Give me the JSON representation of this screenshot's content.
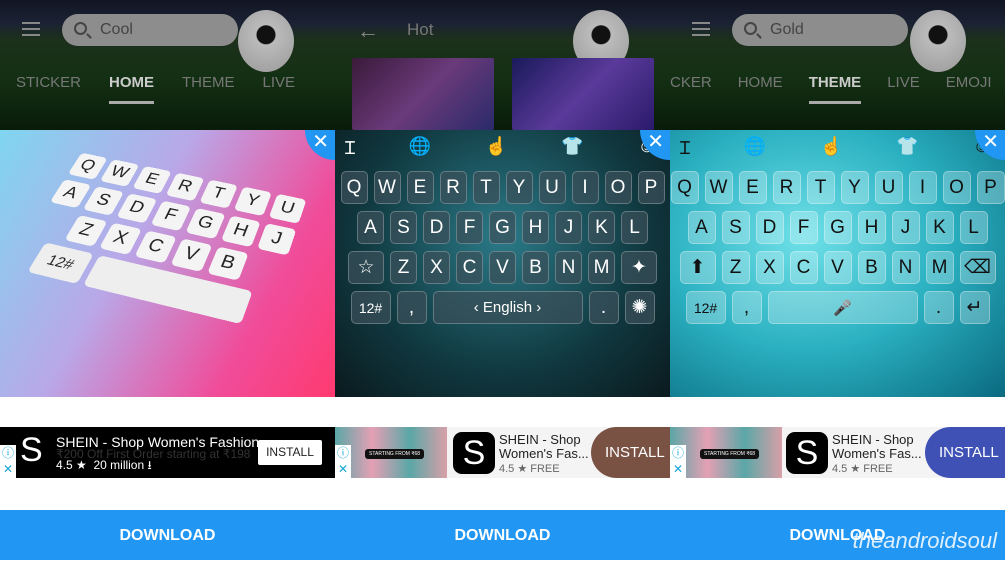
{
  "panels": [
    {
      "search": "Cool",
      "tabs": [
        "STICKER",
        "HOME",
        "THEME",
        "LIVE"
      ],
      "active_tab": "HOME"
    },
    {
      "title": "Hot"
    },
    {
      "search": "Gold",
      "tabs": [
        "CKER",
        "HOME",
        "THEME",
        "LIVE",
        "EMOJI"
      ],
      "active_tab": "THEME"
    }
  ],
  "close_label": "✕",
  "kb1": {
    "rows": [
      [
        "Q",
        "W",
        "E",
        "R",
        "T",
        "Y",
        "U"
      ],
      [
        "A",
        "S",
        "D",
        "F",
        "G",
        "H",
        "J"
      ],
      [
        "Z",
        "X",
        "C",
        "V",
        "B"
      ]
    ],
    "numkey": "12#"
  },
  "kb2": {
    "rows": [
      [
        "Q",
        "W",
        "E",
        "R",
        "T",
        "Y",
        "U",
        "I",
        "O",
        "P"
      ],
      [
        "A",
        "S",
        "D",
        "F",
        "G",
        "H",
        "J",
        "K",
        "L"
      ],
      [
        "☆",
        "Z",
        "X",
        "C",
        "V",
        "B",
        "N",
        "M",
        "✦"
      ]
    ],
    "bottom": [
      "12#",
      ",",
      "‹ English ›",
      ".",
      "✺"
    ],
    "icons": [
      "Ɪ",
      "🌐",
      "☝",
      "👕",
      "☺"
    ]
  },
  "kb3": {
    "rows": [
      [
        "Q",
        "W",
        "E",
        "R",
        "T",
        "Y",
        "U",
        "I",
        "O",
        "P"
      ],
      [
        "A",
        "S",
        "D",
        "F",
        "G",
        "H",
        "J",
        "K",
        "L"
      ],
      [
        "⬆",
        "Z",
        "X",
        "C",
        "V",
        "B",
        "N",
        "M",
        "⌫"
      ]
    ],
    "bottom": [
      "12#",
      ",",
      "🎤",
      ".",
      "↵"
    ],
    "icons": [
      "Ɪ",
      "🌐",
      "☝",
      "👕",
      "☺"
    ]
  },
  "ad1": {
    "title": "SHEIN - Shop Women's Fashion",
    "subtitle": "₹200 Off First Order starting at ₹198",
    "rating": "4.5",
    "downloads": "20 million",
    "install": "INSTALL",
    "logo": "S"
  },
  "ad_small": {
    "title": "SHEIN - Shop Women's Fas...",
    "rating": "4.5 ★ FREE",
    "install": "INSTALL",
    "logo": "S",
    "promo": "STARTING FROM ₹68"
  },
  "colors": {
    "install_brown": "#7a5244",
    "install_blue": "#3f51b5",
    "download_bar": "#2196f3"
  },
  "download": "DOWNLOAD",
  "watermark": "theandroidsoul"
}
